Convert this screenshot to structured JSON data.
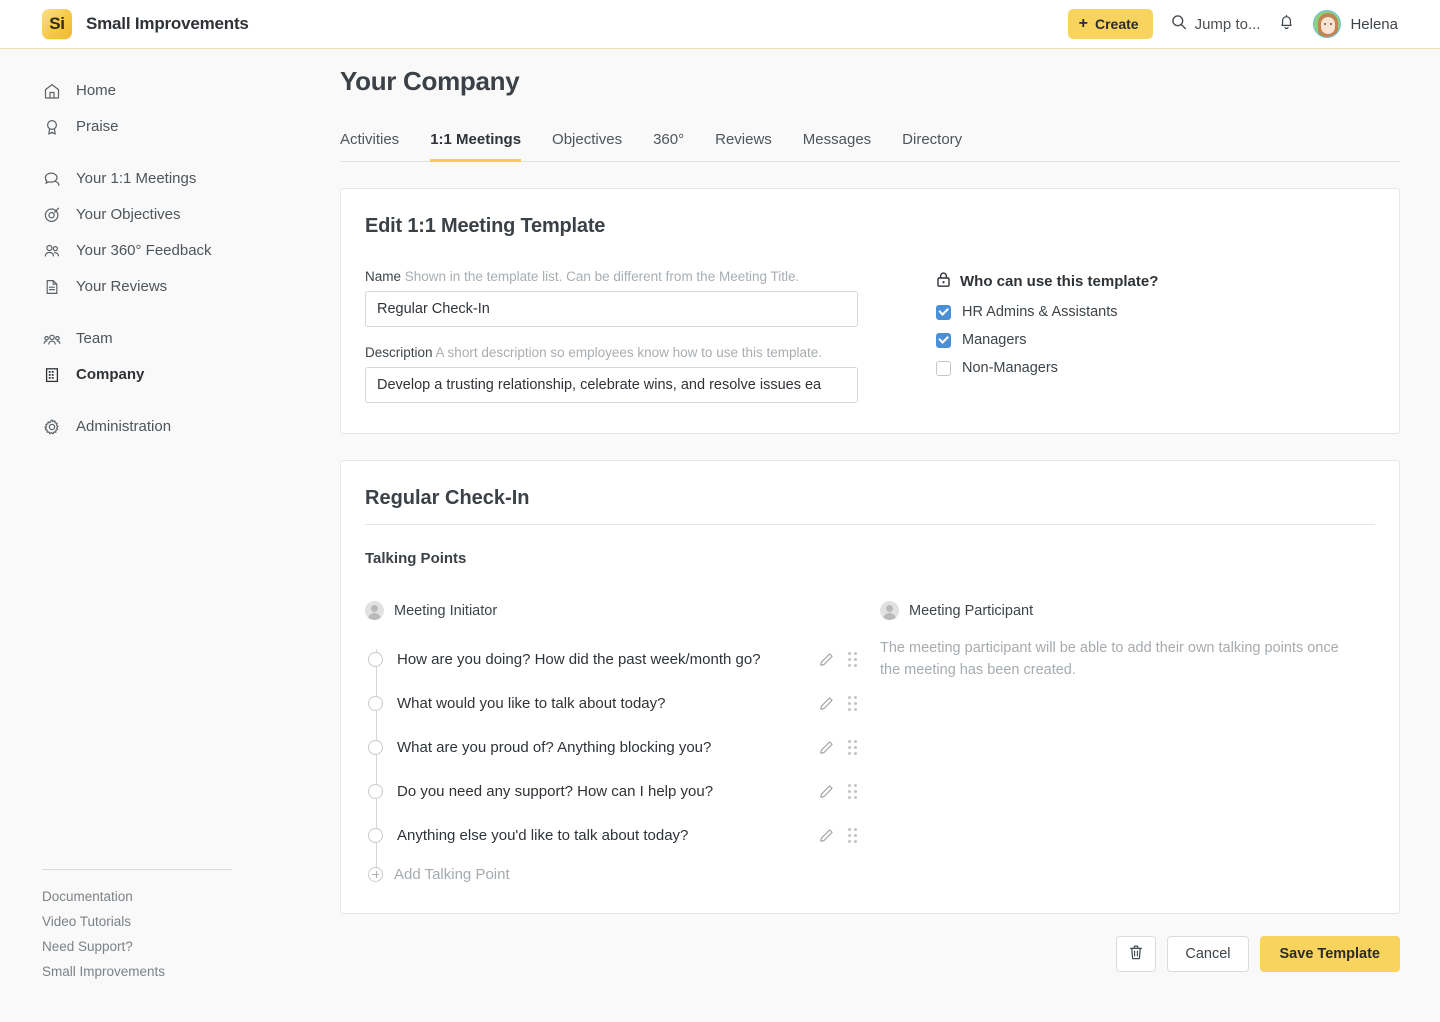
{
  "brand": {
    "logo_text": "Si",
    "name": "Small Improvements"
  },
  "topbar": {
    "create_label": "Create",
    "search_label": "Jump to...",
    "user_name": "Helena"
  },
  "sidebar": {
    "groups": [
      {
        "items": [
          {
            "label": "Home",
            "icon": "home-icon",
            "active": false
          },
          {
            "label": "Praise",
            "icon": "award-icon",
            "active": false
          }
        ]
      },
      {
        "items": [
          {
            "label": "Your 1:1 Meetings",
            "icon": "chat-icon",
            "active": false
          },
          {
            "label": "Your Objectives",
            "icon": "target-icon",
            "active": false
          },
          {
            "label": "Your 360° Feedback",
            "icon": "people-icon",
            "active": false
          },
          {
            "label": "Your Reviews",
            "icon": "document-icon",
            "active": false
          }
        ]
      },
      {
        "items": [
          {
            "label": "Team",
            "icon": "team-icon",
            "active": false
          },
          {
            "label": "Company",
            "icon": "building-icon",
            "active": true
          }
        ]
      },
      {
        "items": [
          {
            "label": "Administration",
            "icon": "gear-icon",
            "active": false
          }
        ]
      }
    ],
    "footer_links": [
      "Documentation",
      "Video Tutorials",
      "Need Support?",
      "Small Improvements"
    ]
  },
  "main": {
    "page_title": "Your Company",
    "tabs": [
      {
        "label": "Activities",
        "active": false
      },
      {
        "label": "1:1 Meetings",
        "active": true
      },
      {
        "label": "Objectives",
        "active": false
      },
      {
        "label": "360°",
        "active": false
      },
      {
        "label": "Reviews",
        "active": false
      },
      {
        "label": "Messages",
        "active": false
      },
      {
        "label": "Directory",
        "active": false
      }
    ]
  },
  "edit_card": {
    "title": "Edit 1:1 Meeting Template",
    "name_field": {
      "label": "Name",
      "hint": "Shown in the template list. Can be different from the Meeting Title.",
      "value": "Regular Check-In",
      "placeholder": "Template name"
    },
    "description_field": {
      "label": "Description",
      "hint": "A short description so employees know how to use this template.",
      "value": "Develop a trusting relationship, celebrate wins, and resolve issues ea",
      "placeholder": "Description"
    },
    "permissions": {
      "title": "Who can use this template?",
      "options": [
        {
          "label": "HR Admins & Assistants",
          "checked": true
        },
        {
          "label": "Managers",
          "checked": true
        },
        {
          "label": "Non-Managers",
          "checked": false
        }
      ]
    }
  },
  "template_card": {
    "title": "Regular Check-In",
    "section_label": "Talking Points",
    "initiator": {
      "role_label": "Meeting Initiator",
      "talking_points": [
        "How are you doing? How did the past week/month go?",
        "What would you like to talk about today?",
        "What are you proud of? Anything blocking you?",
        "Do you need any support? How can I help you?",
        "Anything else you'd like to talk about today?"
      ],
      "add_label": "Add Talking Point"
    },
    "participant": {
      "role_label": "Meeting Participant",
      "note": "The meeting participant will be able to add their own talking points once the meeting has been created."
    }
  },
  "actions": {
    "delete_label": "",
    "cancel_label": "Cancel",
    "save_label": "Save Template"
  },
  "colors": {
    "accent_yellow": "#f8d45e",
    "tab_underline": "#f6cb4e",
    "checkbox_blue": "#4a90d9",
    "page_bg": "#f9f9f9"
  }
}
